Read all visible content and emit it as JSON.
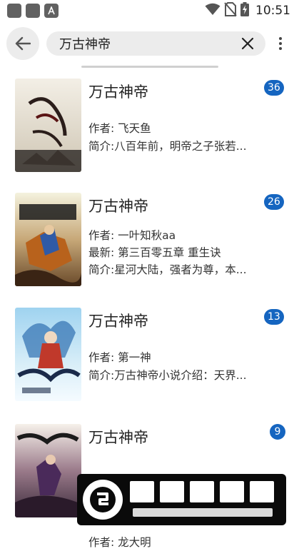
{
  "status_bar": {
    "time": "10:51",
    "left_icons": [
      "app-notification-icon",
      "app-notification-icon",
      "font-app-icon"
    ],
    "right_icons": [
      "wifi-icon",
      "no-sim-icon",
      "battery-charging-icon"
    ]
  },
  "toolbar": {
    "search_value": "万古神帝",
    "back_icon": "arrow-left-icon",
    "clear_icon": "close-icon",
    "more_icon": "more-vertical-icon"
  },
  "books": [
    {
      "title": "万古神帝",
      "author": "作者: 飞天鱼",
      "latest": "",
      "intro": "简介:八百年前，明帝之子张若...",
      "badge": "36"
    },
    {
      "title": "万古神帝",
      "author": "作者: 一叶知秋aa",
      "latest": "最新: 第三百零五章 重生诀",
      "intro": "简介:星河大陆，强者为尊，本...",
      "badge": "26"
    },
    {
      "title": "万古神帝",
      "author": "作者: 第一神",
      "latest": "",
      "intro": "简介:万古神帝小说介绍：天界...",
      "badge": "13"
    },
    {
      "title": "万古神帝",
      "author": "作者: 龙大明",
      "latest": "",
      "intro": "",
      "badge": "9"
    }
  ],
  "watermark": {
    "name": "下载鸟资源",
    "url": "www.xiazainiao.com"
  },
  "colors": {
    "accent": "#1565c0",
    "field_background": "#ececec"
  }
}
